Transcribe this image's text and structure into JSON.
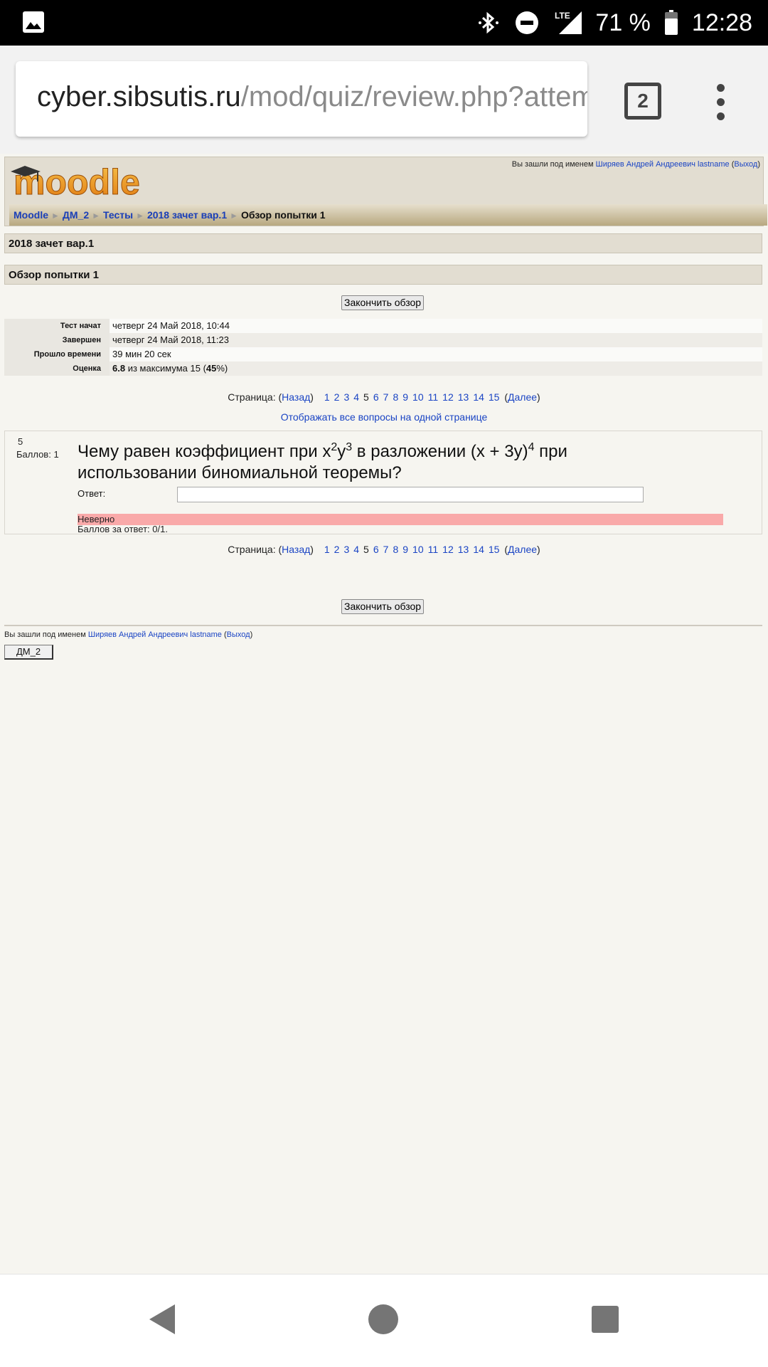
{
  "status_bar": {
    "battery": "71 %",
    "time": "12:28",
    "network": "LTE",
    "icons": [
      "gallery-icon",
      "bluetooth-icon",
      "do-not-disturb-icon",
      "lte-signal-icon",
      "battery-icon"
    ]
  },
  "browser": {
    "url_host": "cyber.sibsutis.ru",
    "url_path": "/mod/quiz/review.php?attemp",
    "tab_count": "2"
  },
  "header": {
    "logo_text": "moodle",
    "login_prefix": "Вы зашли под именем ",
    "user_name": "Ширяев Андрей Андреевич lastname",
    "logout_open": " (",
    "logout": "Выход",
    "logout_close": ")"
  },
  "breadcrumb": {
    "items": [
      "Moodle",
      "ДМ_2",
      "Тесты",
      "2018 зачет вар.1"
    ],
    "current": "Обзор попытки 1",
    "separator": "►"
  },
  "quiz_title": "2018 зачет вар.1",
  "attempt_title": "Обзор попытки 1",
  "finish_review_label": "Закончить обзор",
  "summary": [
    {
      "label": "Тест начат",
      "value": "четверг 24 Май 2018, 10:44"
    },
    {
      "label": "Завершен",
      "value": "четверг 24 Май 2018, 11:23"
    },
    {
      "label": "Прошло времени",
      "value": "39 мин 20 сек"
    }
  ],
  "grade_row": {
    "label": "Оценка",
    "score": "6.8",
    "middle": " из максимума 15 (",
    "percent": "45",
    "suffix": "%)"
  },
  "paging": {
    "prefix": "Страница: (",
    "prev": "Назад",
    "close_prev": ")",
    "pages": [
      "1",
      "2",
      "3",
      "4",
      "5",
      "6",
      "7",
      "8",
      "9",
      "10",
      "11",
      "12",
      "13",
      "14",
      "15"
    ],
    "current_page": "5",
    "open_next": "(",
    "next": "Далее",
    "close_next": ")"
  },
  "show_all": "Отображать все вопросы на одной странице",
  "question": {
    "number": "5",
    "marks": "Баллов: 1",
    "text_part1": "Чему равен коэффициент при x",
    "sup1": "2",
    "text_part2": "y",
    "sup2": "3",
    "text_part3": " в разложении (x + 3y)",
    "sup3": "4",
    "text_part4": " при использовании биномиальной теоремы?",
    "answer_label": "Ответ:",
    "answer_value": "",
    "feedback": "Неверно",
    "grade_text": "Баллов за ответ: 0/1."
  },
  "footer": {
    "course_button": "ДМ_2"
  }
}
